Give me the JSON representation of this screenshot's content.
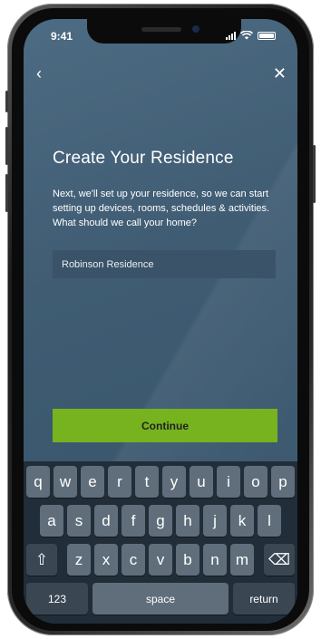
{
  "status_bar": {
    "time": "9:41"
  },
  "nav": {
    "back_glyph": "‹",
    "close_glyph": "✕"
  },
  "main": {
    "title": "Create Your Residence",
    "description": "Next, we'll set up your residence, so we can start setting up devices, rooms, schedules & activities. What should we call your home?",
    "residence_name_value": "Robinson Residence",
    "continue_label": "Continue"
  },
  "keyboard": {
    "row1": [
      "q",
      "w",
      "e",
      "r",
      "t",
      "y",
      "u",
      "i",
      "o",
      "p"
    ],
    "row2": [
      "a",
      "s",
      "d",
      "f",
      "g",
      "h",
      "j",
      "k",
      "l"
    ],
    "row3": [
      "z",
      "x",
      "c",
      "v",
      "b",
      "n",
      "m"
    ],
    "shift_glyph": "⇧",
    "delete_glyph": "⌫",
    "numbers_label": "123",
    "space_label": "space",
    "return_label": "return"
  },
  "colors": {
    "screen_bg": "#3f5c73",
    "accent_green": "#76b31f",
    "keyboard_bg": "#212d38",
    "key_bg": "#5f6e7a"
  }
}
